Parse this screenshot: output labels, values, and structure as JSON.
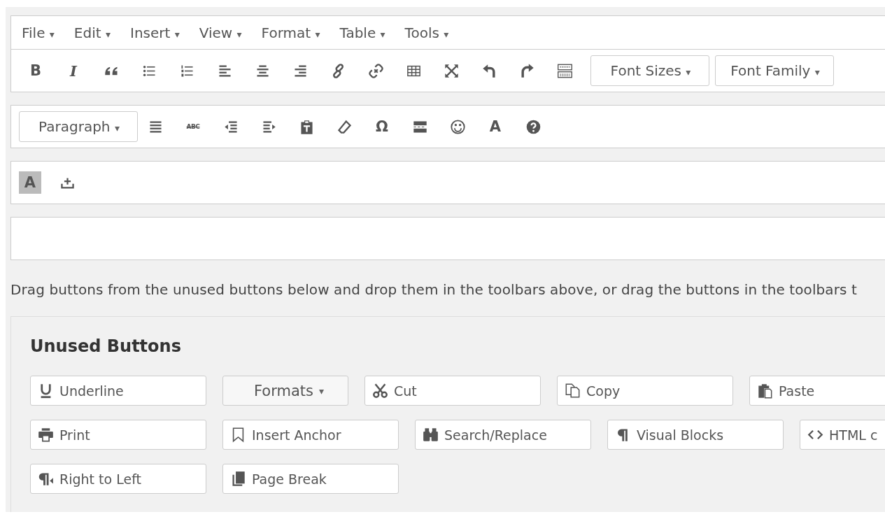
{
  "menubar": [
    {
      "label": "File",
      "caret": "▾"
    },
    {
      "label": "Edit",
      "caret": "▾"
    },
    {
      "label": "Insert",
      "caret": "▾"
    },
    {
      "label": "View",
      "caret": "▾"
    },
    {
      "label": "Format",
      "caret": "▾"
    },
    {
      "label": "Table",
      "caret": "▾"
    },
    {
      "label": "Tools",
      "caret": "▾"
    }
  ],
  "toolbars": [
    {
      "items": [
        {
          "kind": "glyph",
          "text": "B"
        },
        {
          "kind": "glyph",
          "text": "I"
        },
        {
          "kind": "icon"
        },
        {
          "kind": "icon"
        },
        {
          "kind": "icon"
        },
        {
          "kind": "icon"
        },
        {
          "kind": "icon"
        },
        {
          "kind": "icon"
        },
        {
          "kind": "icon"
        },
        {
          "kind": "icon"
        },
        {
          "kind": "icon"
        },
        {
          "kind": "icon"
        },
        {
          "kind": "icon"
        },
        {
          "kind": "icon"
        },
        {
          "kind": "icon"
        },
        {
          "kind": "dropdown",
          "label": "Font Sizes",
          "caret": "▾"
        },
        {
          "kind": "dropdown",
          "label": "Font Family",
          "caret": "▾"
        }
      ]
    },
    {
      "items": [
        {
          "kind": "dropdown",
          "label": "Paragraph",
          "caret": "▾"
        },
        {
          "kind": "icon"
        },
        {
          "kind": "strike",
          "text": "ABC"
        },
        {
          "kind": "icon"
        },
        {
          "kind": "icon"
        },
        {
          "kind": "icon"
        },
        {
          "kind": "icon"
        },
        {
          "kind": "glyph",
          "text": "Ω"
        },
        {
          "kind": "icon"
        },
        {
          "kind": "icon"
        },
        {
          "kind": "glyph",
          "text": "A"
        },
        {
          "kind": "icon"
        }
      ]
    },
    {
      "items": [
        {
          "kind": "glyph",
          "text": "A",
          "selected": true
        },
        {
          "kind": "icon"
        }
      ]
    }
  ],
  "instructions": "Drag buttons from the unused buttons below and drop them in the toolbars above, or drag the buttons in the toolbars t",
  "unused": {
    "title": "Unused Buttons",
    "rows": [
      [
        {
          "kind": "button",
          "label": "Underline"
        },
        {
          "kind": "dropdown",
          "label": "Formats",
          "caret": "▾"
        },
        {
          "kind": "button",
          "label": "Cut"
        },
        {
          "kind": "button",
          "label": "Copy"
        },
        {
          "kind": "button",
          "label": "Paste"
        }
      ],
      [
        {
          "kind": "button",
          "label": "Print"
        },
        {
          "kind": "button",
          "label": "Insert Anchor"
        },
        {
          "kind": "button",
          "label": "Search/Replace"
        },
        {
          "kind": "button",
          "label": "Visual Blocks"
        },
        {
          "kind": "button",
          "label": "HTML c"
        }
      ],
      [
        {
          "kind": "button",
          "label": "Right to Left"
        },
        {
          "kind": "button",
          "label": "Page Break"
        }
      ]
    ]
  }
}
